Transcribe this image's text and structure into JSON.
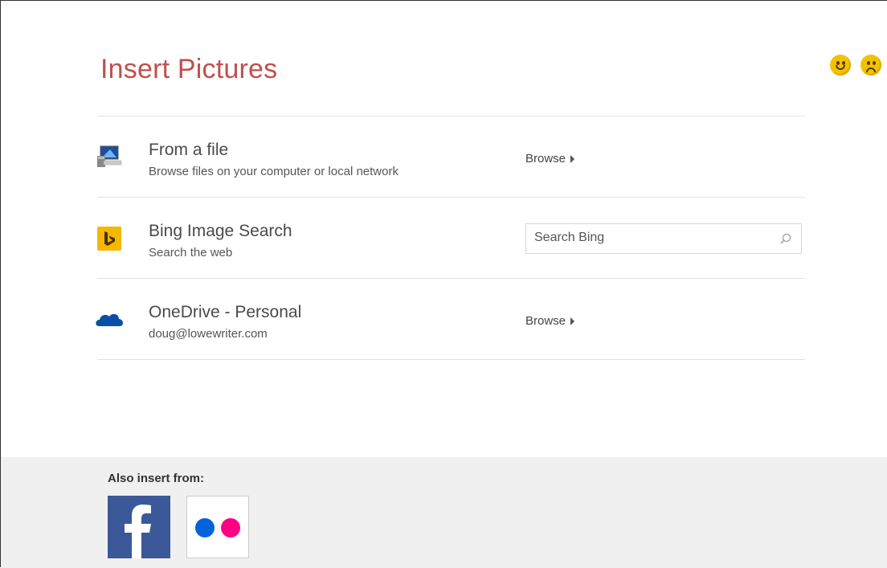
{
  "dialog": {
    "title": "Insert Pictures",
    "feedback": {
      "happy_icon": "smile-face-icon",
      "sad_icon": "frown-face-icon"
    }
  },
  "sources": [
    {
      "id": "file",
      "label": "From a file",
      "description": "Browse files on your computer or local network",
      "action_label": "Browse",
      "icon": "computer-icon"
    },
    {
      "id": "bing",
      "label": "Bing Image Search",
      "description": "Search the web",
      "search_placeholder": "Search Bing",
      "icon": "bing-logo-icon"
    },
    {
      "id": "onedrive",
      "label": "OneDrive - Personal",
      "description": "doug@lowewriter.com",
      "action_label": "Browse",
      "icon": "onedrive-cloud-icon"
    }
  ],
  "footer": {
    "also_insert_label": "Also insert from:",
    "services": [
      {
        "name": "facebook",
        "icon": "facebook-logo-icon"
      },
      {
        "name": "flickr",
        "icon": "flickr-logo-icon"
      }
    ]
  },
  "colors": {
    "title": "#c0504d",
    "bing": "#f5b800",
    "facebook": "#3b5998",
    "flickr_blue": "#0063dc",
    "flickr_pink": "#ff0084",
    "onedrive": "#0a4fa6",
    "footer_bg": "#f0f0f0"
  }
}
